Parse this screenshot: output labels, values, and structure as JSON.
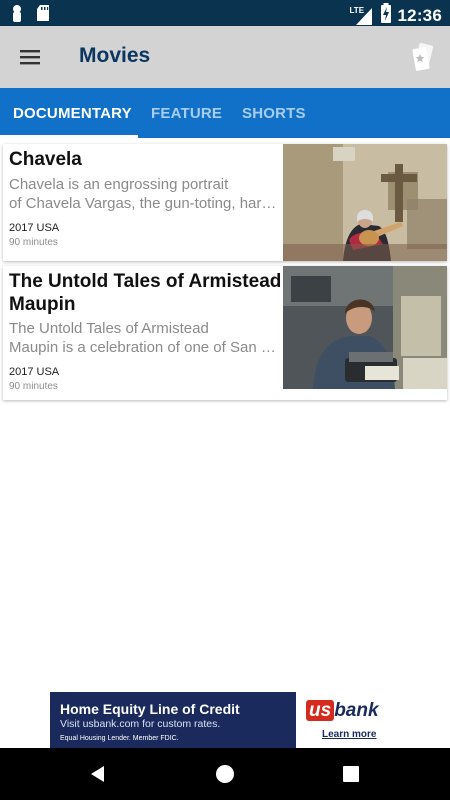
{
  "status_bar": {
    "time": "12:36",
    "network": "LTE",
    "icons": [
      "notification-icon",
      "sd-card-icon",
      "signal-icon",
      "battery-charging-icon"
    ]
  },
  "app_bar": {
    "title": "Movies",
    "left_icon": "menu-icon",
    "right_icon": "tickets-icon"
  },
  "tabs": [
    {
      "label": "DOCUMENTARY",
      "active": true
    },
    {
      "label": "FEATURE",
      "active": false
    },
    {
      "label": "SHORTS",
      "active": false
    }
  ],
  "movies": [
    {
      "title": "Chavela",
      "description_line1": "Chavela is an engrossing portrait",
      "description_line2": "of Chavela Vargas, the gun-toting, har…",
      "meta": "2017 USA",
      "duration": "90 minutes"
    },
    {
      "title_line1": "The Untold Tales of Armistead",
      "title_line2": "Maupin",
      "description_line1": "The Untold Tales of Armistead",
      "description_line2": "Maupin is a celebration of one of San …",
      "meta": "2017 USA",
      "duration": "90 minutes"
    }
  ],
  "ad": {
    "headline": "Home Equity Line of Credit",
    "subline": "Visit usbank.com for custom rates.",
    "fine_print": "Equal Housing Lender. Member FDIC.",
    "logo_us": "us",
    "logo_bank": "bank",
    "cta": "Learn more",
    "colors": {
      "navy": "#1a2a5c",
      "red": "#d52b1e"
    }
  },
  "nav": {
    "back_icon": "back-icon",
    "home_icon": "home-icon",
    "recents_icon": "recents-icon"
  },
  "colors": {
    "status_bar": "#0a3350",
    "app_bar": "#d3d3d3",
    "title": "#0a3660",
    "tab_bar": "#1171c9",
    "tab_active": "#ffffff",
    "tab_inactive": "#a9cdef"
  }
}
